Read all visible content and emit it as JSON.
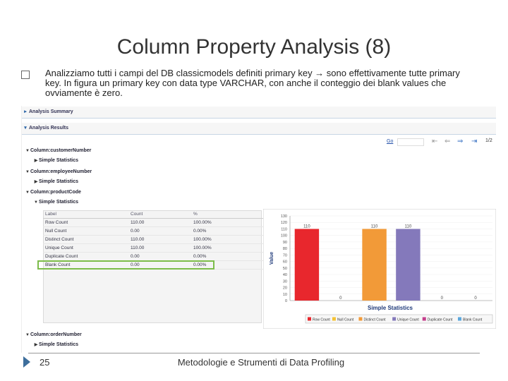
{
  "slide": {
    "title": "Column Property Analysis (8)",
    "body": "Analizziamo tutti i campi del DB classicmodels definiti primary key → sono effettivamente tutte primary key. In figura un primary key con data type VARCHAR, con anche il conteggio dei blank values che ovviamente è zero.",
    "slide_number": "25",
    "footer": "Metodologie e Strumenti di Data Profiling"
  },
  "app": {
    "analysis_summary": "Analysis Summary",
    "analysis_results": "Analysis Results",
    "go_link": "Go",
    "pager": "1/2",
    "tree": [
      {
        "column": "Column:customerNumber",
        "child": "Simple Statistics"
      },
      {
        "column": "Column:employeeNumber",
        "child": "Simple Statistics"
      },
      {
        "column": "Column:productCode",
        "child": "Simple Statistics"
      }
    ],
    "last_column": "Column:orderNumber",
    "last_child": "Simple Statistics",
    "table": {
      "headers": [
        "Label",
        "Count",
        "%"
      ],
      "rows": [
        [
          "Row Count",
          "110.00",
          "100.00%"
        ],
        [
          "Null Count",
          "0.00",
          "0.00%"
        ],
        [
          "Distinct Count",
          "110.00",
          "100.00%"
        ],
        [
          "Unique Count",
          "110.00",
          "100.00%"
        ],
        [
          "Duplicate Count",
          "0.00",
          "0.00%"
        ],
        [
          "Blank Count",
          "0.00",
          "0.00%"
        ]
      ]
    }
  },
  "chart_data": {
    "type": "bar",
    "title": "Simple Statistics",
    "ylabel": "Value",
    "xlabel": "",
    "ylim": [
      0,
      130
    ],
    "yticks": [
      0,
      10,
      20,
      30,
      40,
      50,
      60,
      70,
      80,
      90,
      100,
      110,
      120,
      130
    ],
    "categories": [
      "Row Count",
      "Null Count",
      "Distinct Count",
      "Unique Count",
      "Duplicate Count",
      "Blank Count"
    ],
    "values": [
      110,
      0,
      110,
      110,
      0,
      0
    ],
    "value_labels": [
      "110",
      "0",
      "110",
      "110",
      "0",
      "0"
    ],
    "colors": [
      "#e8272d",
      "#f5c335",
      "#f29a38",
      "#8479bb",
      "#c43f8c",
      "#5da7dc"
    ],
    "legend_position": "bottom"
  },
  "colors": {
    "highlight": "#7cbc4a",
    "section_tri": "#2d66a8",
    "footer_arrow": "#3d6e9c"
  }
}
